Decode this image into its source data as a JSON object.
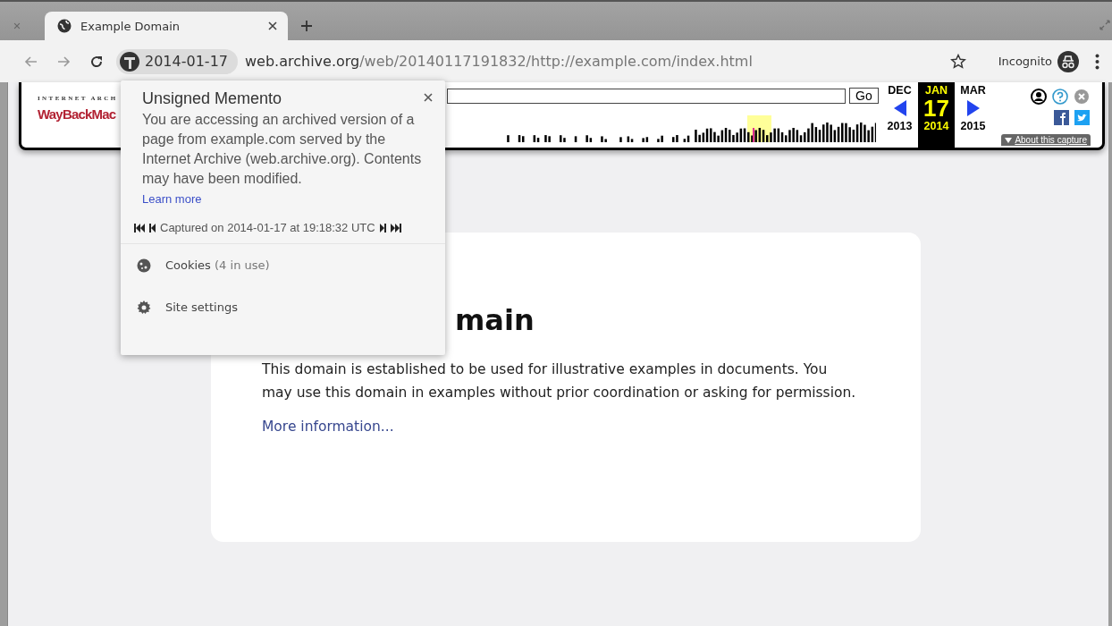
{
  "tabs": [
    {
      "selected": false
    },
    {
      "title": "Example Domain",
      "selected": true
    }
  ],
  "toolbar": {
    "date_chip": "2014-01-17",
    "url_host": "web.archive.org",
    "url_path": "/web/20140117191832/http://example.com/index.html",
    "profile_label": "Incognito"
  },
  "wayback": {
    "logo_top": "INTERNET ARCH",
    "logo_main": "WayBackMac",
    "go": "Go",
    "prev": {
      "month": "DEC",
      "year": "2013"
    },
    "current": {
      "month": "JAN",
      "day": "17",
      "year": "2014"
    },
    "next": {
      "month": "MAR",
      "year": "2015"
    },
    "about": "About this capture"
  },
  "popup": {
    "title": "Unsigned Memento",
    "body": "You are accessing an archived version of a page from example.com served by the Internet Archive (web.archive.org). Contents may have been modified.",
    "link": "Learn more",
    "capture": "Captured on 2014-01-17 at 19:18:32 UTC",
    "items": [
      {
        "kind": "cookies",
        "label": "Cookies",
        "detail": "(4 in use)"
      },
      {
        "kind": "settings",
        "label": "Site settings"
      }
    ]
  },
  "page": {
    "heading": "main",
    "paragraph": "This domain is established to be used for illustrative examples in documents. You may use this domain in examples without prior coordination or asking for permission.",
    "link": "More information..."
  }
}
